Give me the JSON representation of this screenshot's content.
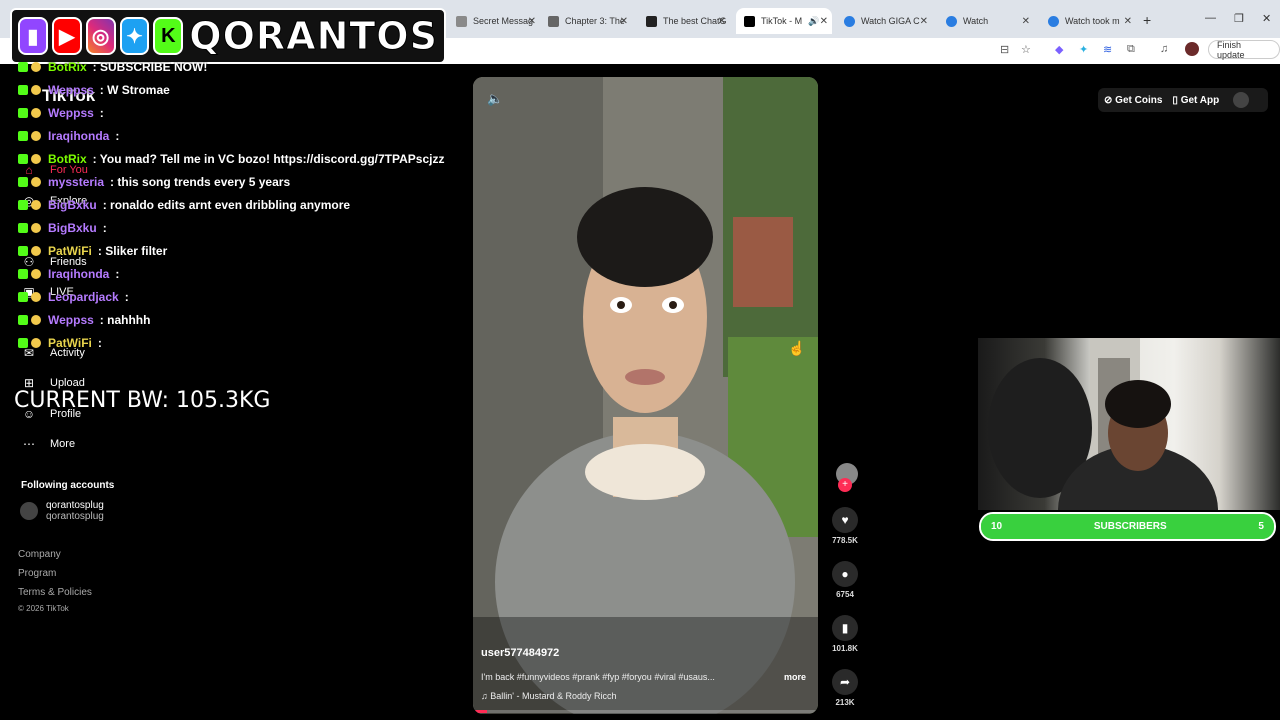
{
  "browser": {
    "tabs": [
      {
        "label": "Secret Messag",
        "color": "#8a8a8a"
      },
      {
        "label": "Chapter 3: The",
        "color": "#666666"
      },
      {
        "label": "The best ChatG",
        "color": "#222222"
      },
      {
        "label": "TikTok - M",
        "color": "#000000",
        "active": true
      },
      {
        "label": "Watch GIGA C",
        "color": "#2a7de1"
      },
      {
        "label": "Watch",
        "color": "#2a7de1"
      },
      {
        "label": "Watch took m",
        "color": "#2a7de1"
      }
    ],
    "finish_update": "Finish update"
  },
  "overlay": {
    "logo_text": "QORANTOS",
    "body_weight": "CURRENT BW: 105.3KG",
    "chat": [
      {
        "user": "BotRix",
        "user_color": "#7cfc00",
        "message": ": SUBSCRIBE NOW!",
        "badge": "#39d03e"
      },
      {
        "user": "Weppss",
        "user_color": "#b57bff",
        "message": ": W Stromae",
        "badge": "#39d03e"
      },
      {
        "user": "Weppss",
        "user_color": "#b57bff",
        "message": ":",
        "badge": "#39d03e"
      },
      {
        "user": "Iraqihonda",
        "user_color": "#b57bff",
        "message": ":",
        "badge": "#39d03e"
      },
      {
        "user": "BotRix",
        "user_color": "#7cfc00",
        "message": ": You mad? Tell me in VC bozo! https://discord.gg/7TPAPscjzz",
        "badge": "#39d03e"
      },
      {
        "user": "myssteria",
        "user_color": "#b57bff",
        "message": ": this song trends every 5 years",
        "badge": "#39d03e"
      },
      {
        "user": "BigBxku",
        "user_color": "#b57bff",
        "message": ": ronaldo edits arnt even dribbling anymore",
        "badge": "#39d03e"
      },
      {
        "user": "BigBxku",
        "user_color": "#b57bff",
        "message": ":",
        "badge": "#39d03e"
      },
      {
        "user": "PatWiFi",
        "user_color": "#e8d44d",
        "message": ": Sliker filter",
        "badge": "#39d03e"
      },
      {
        "user": "Iraqihonda",
        "user_color": "#b57bff",
        "message": ":",
        "badge": "#39d03e"
      },
      {
        "user": "Leopardjack",
        "user_color": "#b57bff",
        "message": ":",
        "badge": "#39d03e"
      },
      {
        "user": "Weppss",
        "user_color": "#b57bff",
        "message": ": nahhhh",
        "badge": "#39d03e"
      },
      {
        "user": "PatWiFi",
        "user_color": "#e8d44d",
        "message": ":",
        "badge": "#39d03e"
      }
    ],
    "subscribers": {
      "left": "10",
      "label": "SUBSCRIBERS",
      "right": "5"
    }
  },
  "tiktok": {
    "logo": "TikTok",
    "sidebar": [
      {
        "label": "For You",
        "icon": "home-icon",
        "active": true
      },
      {
        "label": "Explore",
        "icon": "compass-icon"
      },
      {
        "label": "Friends",
        "icon": "friends-icon"
      },
      {
        "label": "LIVE",
        "icon": "live-icon"
      },
      {
        "label": "Activity",
        "icon": "inbox-icon"
      },
      {
        "label": "Upload",
        "icon": "plus-icon"
      },
      {
        "label": "Profile",
        "icon": "user-icon"
      },
      {
        "label": "More",
        "icon": "more-icon"
      }
    ],
    "following_title": "Following accounts",
    "following": {
      "name": "qorantosplug",
      "handle": "qorantosplug"
    },
    "footer": [
      "Company",
      "Program",
      "Terms & Policies",
      "© 2026 TikTok"
    ],
    "top_right": {
      "coins": "Get Coins",
      "app": "Get App"
    },
    "video": {
      "user": "user577484972",
      "caption": "I'm back #funnyvideos #prank #fyp #foryou #viral #usaus...",
      "more": "more",
      "song": "Ballin' - Mustard & Roddy Ricch",
      "progress": 0.04
    },
    "actions": {
      "likes": "778.5K",
      "comments": "6754",
      "saves": "101.8K",
      "shares": "213K"
    }
  }
}
